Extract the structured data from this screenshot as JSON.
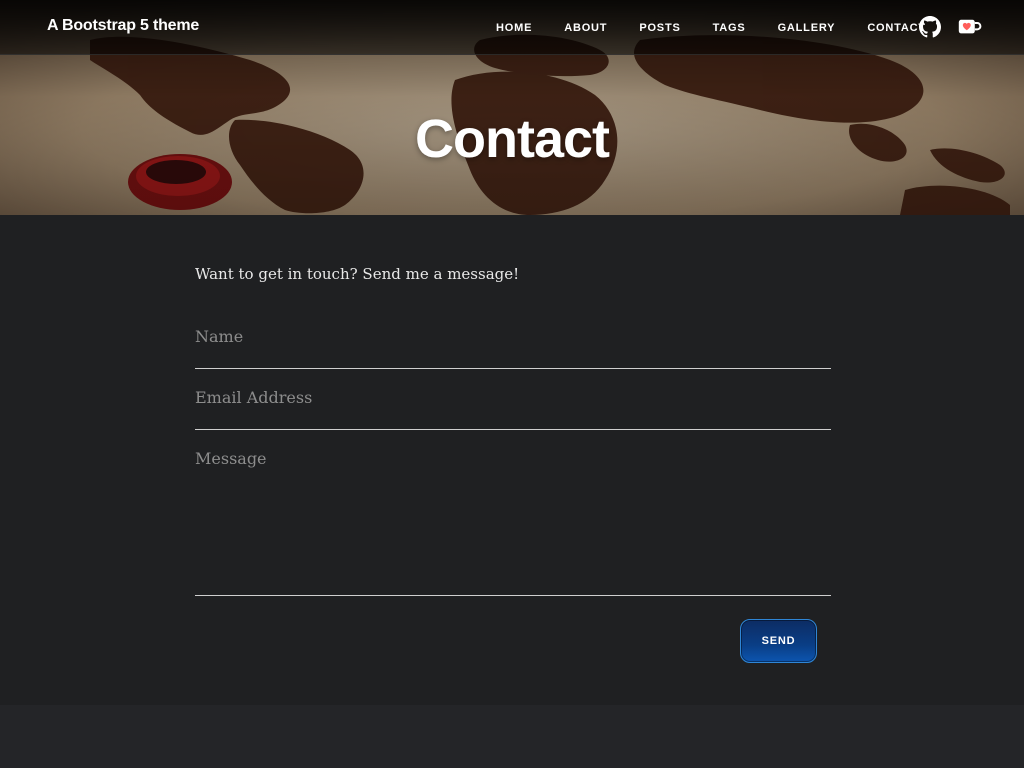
{
  "navbar": {
    "brand": "A Bootstrap 5 theme",
    "links": [
      {
        "label": "HOME"
      },
      {
        "label": "ABOUT"
      },
      {
        "label": "POSTS"
      },
      {
        "label": "TAGS"
      },
      {
        "label": "GALLERY"
      },
      {
        "label": "CONTACT"
      }
    ],
    "icons": [
      "github-icon",
      "kofi-cup-icon"
    ]
  },
  "hero": {
    "title": "Contact"
  },
  "form": {
    "intro": "Want to get in touch? Send me a message!",
    "name_placeholder": "Name",
    "email_placeholder": "Email Address",
    "message_placeholder": "Message",
    "send_label": "SEND"
  },
  "colors": {
    "page_background": "#1f2022",
    "button_gradient_top": "#0d2c63",
    "button_gradient_bottom": "#0c55b0",
    "button_border": "#2f86d6"
  }
}
